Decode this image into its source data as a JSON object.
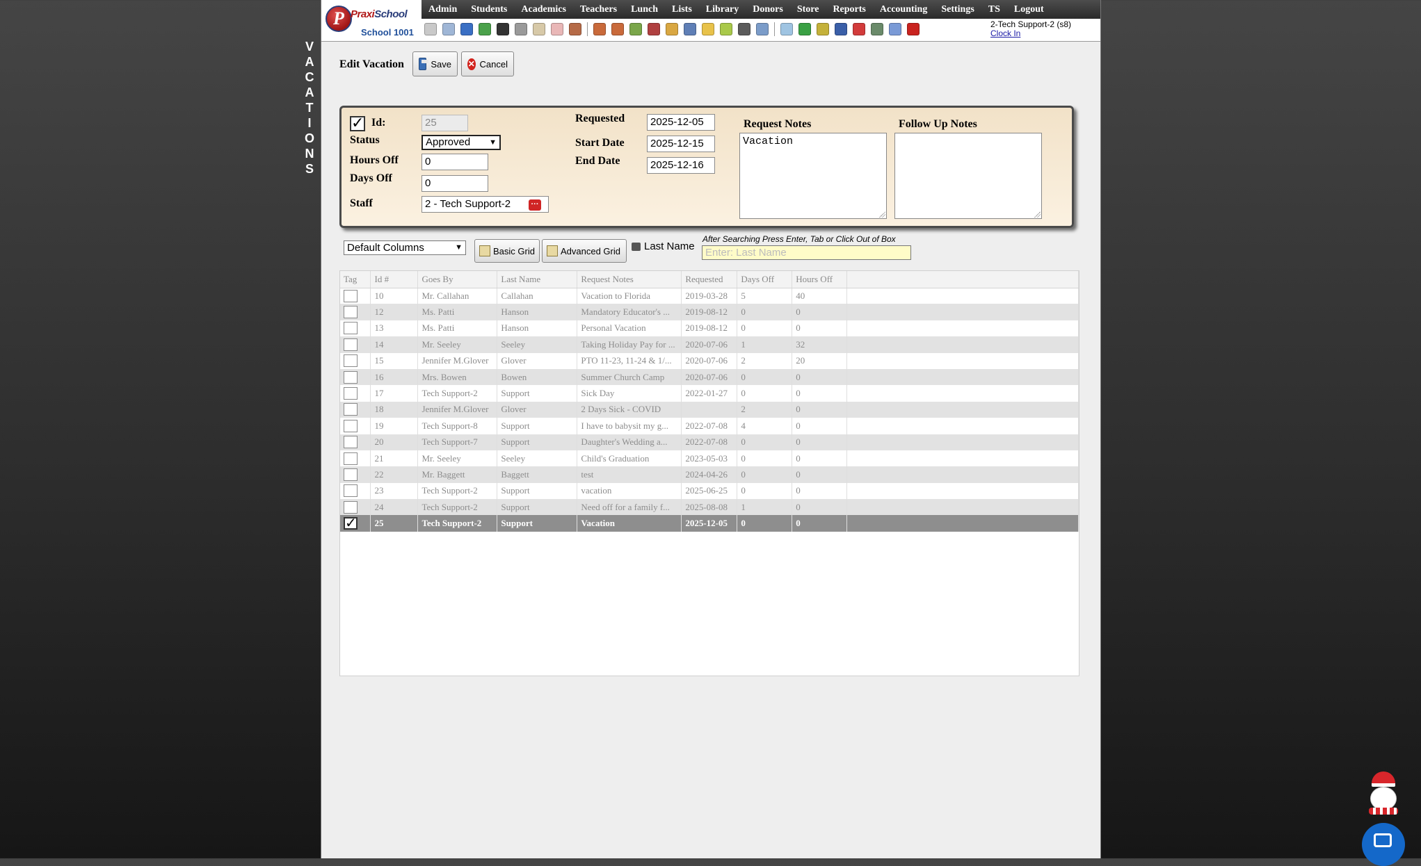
{
  "side_title": [
    "V",
    "A",
    "C",
    "A",
    "T",
    "I",
    "O",
    "N",
    "S"
  ],
  "header": {
    "logo_text_a": "Pra",
    "logo_text_b": "xi",
    "logo_text_c": "School",
    "logo_school": "School 1001",
    "nav": [
      "Admin",
      "Students",
      "Academics",
      "Teachers",
      "Lunch",
      "Lists",
      "Library",
      "Donors",
      "Store",
      "Reports",
      "Accounting",
      "Settings",
      "TS",
      "Logout"
    ],
    "tool_icons": [
      {
        "name": "search-icon",
        "color": "#c9c9c9"
      },
      {
        "name": "grid-icon",
        "color": "#9fb6d6"
      },
      {
        "name": "email-icon",
        "color": "#3a6fc4"
      },
      {
        "name": "money-icon",
        "color": "#4aa14a"
      },
      {
        "name": "phone-icon",
        "color": "#333333"
      },
      {
        "name": "speaker-icon",
        "color": "#9a9a9a"
      },
      {
        "name": "checklist-icon",
        "color": "#d7c9a8"
      },
      {
        "name": "calendar-icon",
        "color": "#e9b7b7"
      },
      {
        "name": "megaphone-icon",
        "color": "#b56a47"
      },
      {
        "name": "alert-person-icon",
        "color": "#c96a3b"
      },
      {
        "name": "user-alert-icon",
        "color": "#c96a3b"
      },
      {
        "name": "pencil-icon",
        "color": "#7aa64a"
      },
      {
        "name": "users-icon",
        "color": "#b04040"
      },
      {
        "name": "ticket-icon",
        "color": "#d9a742"
      },
      {
        "name": "book-icon",
        "color": "#5f7fb6"
      },
      {
        "name": "note-icon",
        "color": "#e8c24a"
      },
      {
        "name": "envelope-icon",
        "color": "#a9c94a"
      },
      {
        "name": "person-icon",
        "color": "#5b5b5b"
      },
      {
        "name": "clock-icon",
        "color": "#7b9cc9"
      },
      {
        "name": "sheet-icon",
        "color": "#9fc4e2"
      },
      {
        "name": "card-icon",
        "color": "#3aa044"
      },
      {
        "name": "printer-icon",
        "color": "#c4b13a"
      },
      {
        "name": "ap-icon",
        "color": "#3a5fa8"
      },
      {
        "name": "pdf-icon",
        "color": "#d23b3b"
      },
      {
        "name": "cash-icon",
        "color": "#6a8a6a"
      },
      {
        "name": "help-icon",
        "color": "#7a9ad6"
      },
      {
        "name": "power-icon",
        "color": "#c9231f"
      }
    ],
    "user": "2-Tech Support-2 (s8)",
    "clock_in": "Clock In"
  },
  "edit": {
    "title": "Edit Vacation",
    "save": "Save",
    "cancel": "Cancel"
  },
  "form": {
    "id_label": "Id:",
    "id_value": "25",
    "status_label": "Status",
    "status_value": "Approved",
    "hours_label": "Hours Off",
    "hours_value": "0",
    "days_label": "Days Off",
    "days_value": "0",
    "staff_label": "Staff",
    "staff_value": "2 - Tech Support-2",
    "requested_label": "Requested",
    "requested_value": "2025-12-05",
    "start_label": "Start Date",
    "start_value": "2025-12-15",
    "end_label": "End Date",
    "end_value": "2025-12-16",
    "request_notes_label": "Request Notes",
    "request_notes_value": "Vacation",
    "followup_label": "Follow Up Notes",
    "followup_value": ""
  },
  "grid_controls": {
    "columns_select": "Default Columns",
    "basic_grid": "Basic Grid",
    "advanced_grid": "Advanced Grid",
    "last_name_label": "Last Name",
    "hint": "After Searching Press Enter, Tab or Click Out of Box",
    "last_name_placeholder": "Enter: Last Name"
  },
  "table": {
    "headers": [
      "Tag",
      "Id #",
      "Goes By",
      "Last Name",
      "Request Notes",
      "Requested",
      "Days Off",
      "Hours Off"
    ],
    "rows": [
      {
        "id": "10",
        "goes_by": "Mr. Callahan",
        "last": "Callahan",
        "notes": "Vacation to Florida",
        "requested": "2019-03-28",
        "days": "5",
        "hours": "40",
        "checked": false
      },
      {
        "id": "12",
        "goes_by": "Ms. Patti",
        "last": "Hanson",
        "notes": "Mandatory Educator's ...",
        "requested": "2019-08-12",
        "days": "0",
        "hours": "0",
        "checked": false
      },
      {
        "id": "13",
        "goes_by": "Ms. Patti",
        "last": "Hanson",
        "notes": "Personal Vacation",
        "requested": "2019-08-12",
        "days": "0",
        "hours": "0",
        "checked": false
      },
      {
        "id": "14",
        "goes_by": "Mr. Seeley",
        "last": "Seeley",
        "notes": "Taking Holiday Pay for ...",
        "requested": "2020-07-06",
        "days": "1",
        "hours": "32",
        "checked": false
      },
      {
        "id": "15",
        "goes_by": "Jennifer M.Glover",
        "last": "Glover",
        "notes": "PTO 11-23, 11-24 & 1/...",
        "requested": "2020-07-06",
        "days": "2",
        "hours": "20",
        "checked": false
      },
      {
        "id": "16",
        "goes_by": "Mrs. Bowen",
        "last": "Bowen",
        "notes": "Summer Church Camp",
        "requested": "2020-07-06",
        "days": "0",
        "hours": "0",
        "checked": false
      },
      {
        "id": "17",
        "goes_by": "Tech Support-2",
        "last": "Support",
        "notes": "Sick Day",
        "requested": "2022-01-27",
        "days": "0",
        "hours": "0",
        "checked": false
      },
      {
        "id": "18",
        "goes_by": "Jennifer M.Glover",
        "last": "Glover",
        "notes": "2 Days Sick - COVID",
        "requested": "",
        "days": "2",
        "hours": "0",
        "checked": false
      },
      {
        "id": "19",
        "goes_by": "Tech Support-8",
        "last": "Support",
        "notes": "I have to babysit my g...",
        "requested": "2022-07-08",
        "days": "4",
        "hours": "0",
        "checked": false
      },
      {
        "id": "20",
        "goes_by": "Tech Support-7",
        "last": "Support",
        "notes": "Daughter's Wedding a...",
        "requested": "2022-07-08",
        "days": "0",
        "hours": "0",
        "checked": false
      },
      {
        "id": "21",
        "goes_by": "Mr. Seeley",
        "last": "Seeley",
        "notes": "Child's Graduation",
        "requested": "2023-05-03",
        "days": "0",
        "hours": "0",
        "checked": false
      },
      {
        "id": "22",
        "goes_by": "Mr. Baggett",
        "last": "Baggett",
        "notes": "test",
        "requested": "2024-04-26",
        "days": "0",
        "hours": "0",
        "checked": false
      },
      {
        "id": "23",
        "goes_by": "Tech Support-2",
        "last": "Support",
        "notes": "vacation",
        "requested": "2025-06-25",
        "days": "0",
        "hours": "0",
        "checked": false
      },
      {
        "id": "24",
        "goes_by": "Tech Support-2",
        "last": "Support",
        "notes": "Need off for a family f...",
        "requested": "2025-08-08",
        "days": "1",
        "hours": "0",
        "checked": false
      },
      {
        "id": "25",
        "goes_by": "Tech Support-2",
        "last": "Support",
        "notes": "Vacation",
        "requested": "2025-12-05",
        "days": "0",
        "hours": "0",
        "checked": true
      }
    ]
  }
}
